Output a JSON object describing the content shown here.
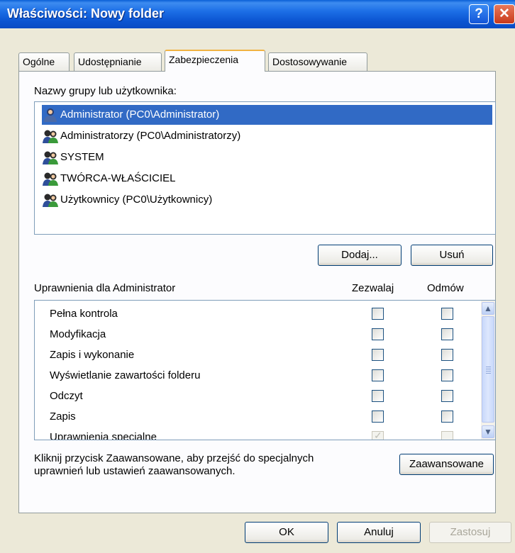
{
  "window": {
    "title": "Właściwości: Nowy folder"
  },
  "tabs": [
    {
      "label": "Ogólne"
    },
    {
      "label": "Udostępnianie"
    },
    {
      "label": "Zabezpieczenia",
      "active": true
    },
    {
      "label": "Dostosowywanie"
    }
  ],
  "users": {
    "label": "Nazwy grupy lub użytkownika:",
    "items": [
      {
        "name": "Administrator (PC0\\Administrator)",
        "selected": true
      },
      {
        "name": "Administratorzy (PC0\\Administratorzy)"
      },
      {
        "name": "SYSTEM"
      },
      {
        "name": "TWÓRCA-WŁAŚCICIEL"
      },
      {
        "name": "Użytkownicy (PC0\\Użytkownicy)"
      }
    ]
  },
  "buttons": {
    "add": "Dodaj...",
    "remove": "Usuń",
    "advanced": "Zaawansowane",
    "ok": "OK",
    "cancel": "Anuluj",
    "apply": "Zastosuj"
  },
  "permissions": {
    "label": "Uprawnienia dla Administrator",
    "col_allow": "Zezwalaj",
    "col_deny": "Odmów",
    "items": [
      {
        "name": "Pełna kontrola",
        "allow": false,
        "deny": false
      },
      {
        "name": "Modyfikacja",
        "allow": false,
        "deny": false
      },
      {
        "name": "Zapis i wykonanie",
        "allow": false,
        "deny": false
      },
      {
        "name": "Wyświetlanie zawartości folderu",
        "allow": false,
        "deny": false
      },
      {
        "name": "Odczyt",
        "allow": false,
        "deny": false
      },
      {
        "name": "Zapis",
        "allow": false,
        "deny": false
      },
      {
        "name": "Uprawnienia specjalne",
        "allow": true,
        "deny": false
      }
    ]
  },
  "footer": {
    "info": "Kliknij przycisk Zaawansowane, aby przejść do specjalnych uprawnień lub ustawień zaawansowanych."
  }
}
